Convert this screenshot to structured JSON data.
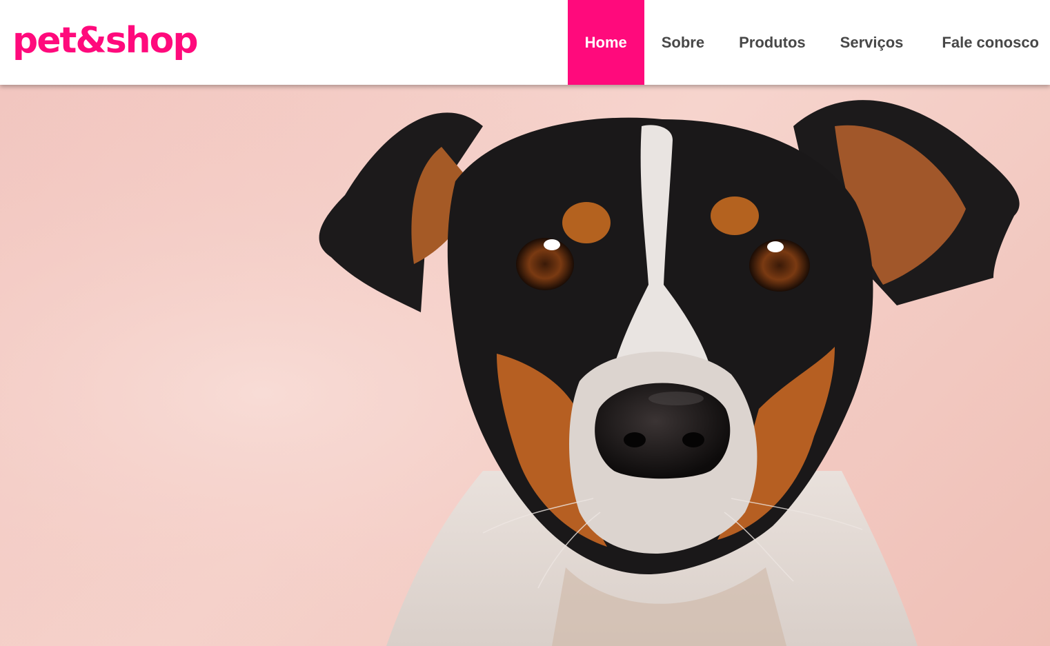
{
  "header": {
    "logo_text": "pet&shop",
    "nav": [
      {
        "label": "Home",
        "active": true
      },
      {
        "label": "Sobre",
        "active": false
      },
      {
        "label": "Produtos",
        "active": false
      },
      {
        "label": "Serviços",
        "active": false
      },
      {
        "label": "Fale conosco",
        "active": false
      }
    ]
  },
  "hero": {
    "image": "dog-portrait-photo"
  },
  "colors": {
    "brand": "#ff0a7c",
    "nav_text": "#474747",
    "hero_background": "#f3c9c2"
  }
}
